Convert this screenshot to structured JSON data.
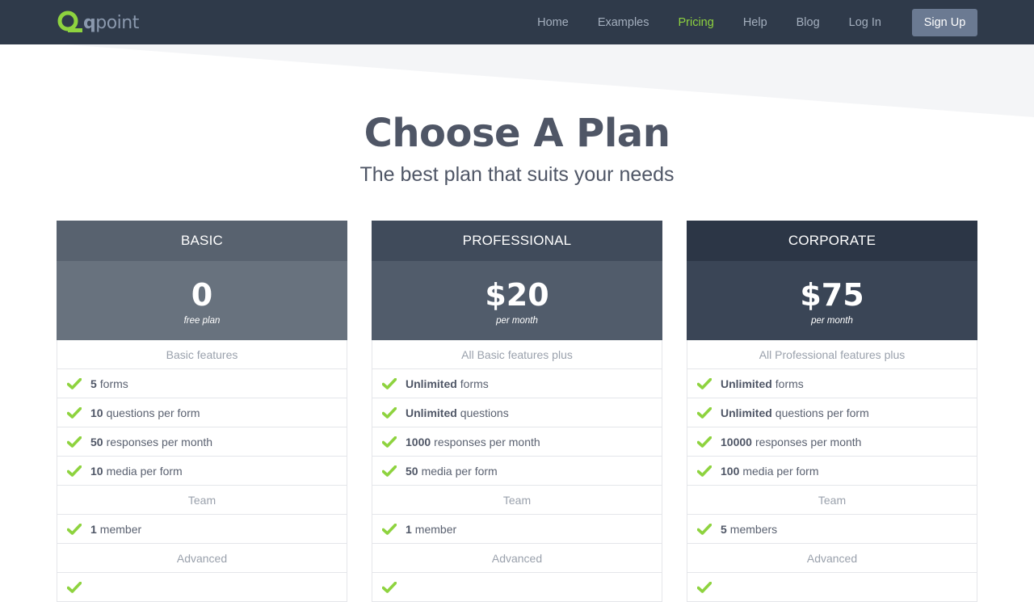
{
  "nav": {
    "logo_q": "q",
    "logo_rest": "point",
    "links": [
      "Home",
      "Examples",
      "Pricing",
      "Help",
      "Blog",
      "Log In"
    ],
    "active": "Pricing",
    "signup": "Sign Up"
  },
  "hero": {
    "title": "Choose A Plan",
    "subtitle": "The best plan that suits your needs"
  },
  "colors": {
    "navbar": "#2f3a4a",
    "accent_green": "#8ed33f",
    "basic_header": "#58626f",
    "basic_price": "#68727e",
    "professional_header": "#404b5b",
    "professional_price": "#515c6b",
    "corporate_header": "#2c3646",
    "corporate_price": "#3a4556"
  },
  "plans": [
    {
      "name": "BASIC",
      "price": "0",
      "period": "free plan",
      "intro": "Basic features",
      "features": [
        {
          "bold": "5",
          "text": "forms"
        },
        {
          "bold": "10",
          "text": "questions per form"
        },
        {
          "bold": "50",
          "text": "responses per month"
        },
        {
          "bold": "10",
          "text": "media per form"
        }
      ],
      "team_label": "Team",
      "team": [
        {
          "bold": "1",
          "text": "member"
        }
      ],
      "advanced_label": "Advanced"
    },
    {
      "name": "PROFESSIONAL",
      "price": "$20",
      "period": "per month",
      "intro": "All Basic features plus",
      "features": [
        {
          "bold": "Unlimited",
          "text": "forms"
        },
        {
          "bold": "Unlimited",
          "text": "questions"
        },
        {
          "bold": "1000",
          "text": "responses per month"
        },
        {
          "bold": "50",
          "text": "media per form"
        }
      ],
      "team_label": "Team",
      "team": [
        {
          "bold": "1",
          "text": "member"
        }
      ],
      "advanced_label": "Advanced"
    },
    {
      "name": "CORPORATE",
      "price": "$75",
      "period": "per month",
      "intro": "All Professional features plus",
      "features": [
        {
          "bold": "Unlimited",
          "text": "forms"
        },
        {
          "bold": "Unlimited",
          "text": "questions per form"
        },
        {
          "bold": "10000",
          "text": "responses per month"
        },
        {
          "bold": "100",
          "text": "media per form"
        }
      ],
      "team_label": "Team",
      "team": [
        {
          "bold": "5",
          "text": "members"
        }
      ],
      "advanced_label": "Advanced"
    }
  ],
  "icons": {
    "check": "check-icon",
    "logo": "qpoint-logo-icon"
  }
}
